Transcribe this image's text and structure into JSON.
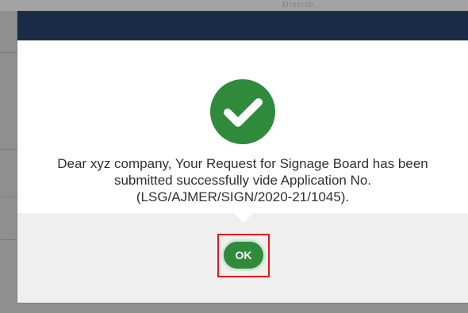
{
  "background": {
    "top_text": "Distrib..."
  },
  "dialog": {
    "icon": "check-circle-icon",
    "icon_color": "#2f8a3c",
    "header_color": "#1a2b46",
    "message_lines": [
      "Dear xyz company, Your Request for Signage Board has been",
      "submitted successfully vide Application No.",
      "(LSG/AJMER/SIGN/2020-21/1045)."
    ],
    "ok_label": "OK",
    "highlight_color": "#e8141c"
  }
}
